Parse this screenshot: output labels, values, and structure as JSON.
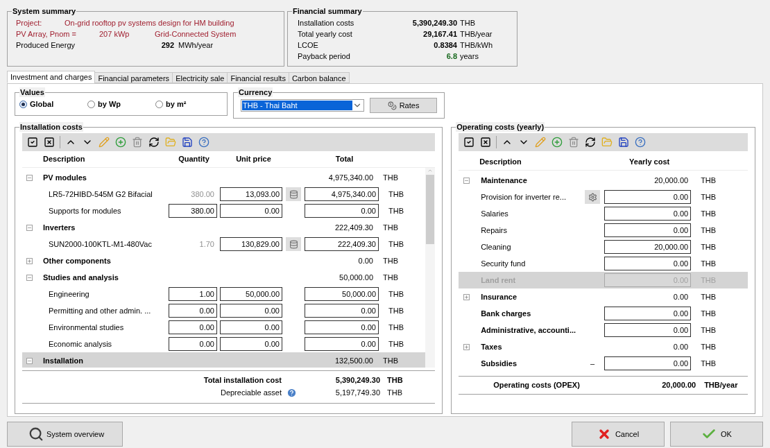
{
  "system_summary": {
    "title": "System summary",
    "rows": [
      {
        "label": "Project:",
        "value": "On-grid rooftop pv systems design for HM building",
        "kind": "project"
      },
      {
        "label": "PV Array, Pnom =",
        "value": "207 kWp",
        "extra": "Grid-Connected System",
        "kind": "array"
      },
      {
        "label": "Produced Energy",
        "value": "292",
        "unit": "MWh/year",
        "kind": "energy"
      }
    ]
  },
  "financial_summary": {
    "title": "Financial summary",
    "rows": [
      {
        "label": "Installation costs",
        "value": "5,390,249.30",
        "unit": "THB",
        "highlight": false
      },
      {
        "label": "Total yearly cost",
        "value": "29,167.41",
        "unit": "THB/year",
        "highlight": false
      },
      {
        "label": "LCOE",
        "value": "0.8384",
        "unit": "THB/kWh",
        "highlight": false
      },
      {
        "label": "Payback period",
        "value": "6.8",
        "unit": "years",
        "highlight": true
      }
    ]
  },
  "tabs": [
    {
      "label": "Investment and charges",
      "selected": true
    },
    {
      "label": "Financial parameters",
      "selected": false
    },
    {
      "label": "Electricity sale",
      "selected": false
    },
    {
      "label": "Financial results",
      "selected": false
    },
    {
      "label": "Carbon balance",
      "selected": false
    }
  ],
  "values": {
    "title": "Values",
    "options": [
      {
        "label": "Global",
        "selected": true
      },
      {
        "label": "by Wp",
        "selected": false
      },
      {
        "label": "by m²",
        "selected": false
      }
    ]
  },
  "currency": {
    "title": "Currency",
    "value": "THB - Thai Baht",
    "button": "Rates"
  },
  "installation_costs": {
    "title": "Installation costs",
    "columns": [
      "Description",
      "Quantity",
      "Unit price",
      "Total"
    ],
    "rows": [
      {
        "kind": "group",
        "label": "PV modules",
        "expanded": true,
        "total": "4,975,340.00",
        "unit": "THB",
        "selected": false
      },
      {
        "kind": "item",
        "label": "LR5-72HIBD-545M G2 Bifacial",
        "quantity": "380.00",
        "quantity_locked": true,
        "unit_price": "13,093.00",
        "database": true,
        "total": "4,975,340.00",
        "unit": "THB"
      },
      {
        "kind": "item",
        "label": "Supports for modules",
        "quantity": "380.00",
        "quantity_locked": false,
        "unit_price": "0.00",
        "database": false,
        "total": "0.00",
        "unit": "THB"
      },
      {
        "kind": "group",
        "label": "Inverters",
        "expanded": true,
        "total": "222,409.30",
        "unit": "THB",
        "selected": false
      },
      {
        "kind": "item",
        "label": "SUN2000-100KTL-M1-480Vac",
        "quantity": "1.70",
        "quantity_locked": true,
        "unit_price": "130,829.00",
        "database": true,
        "total": "222,409.30",
        "unit": "THB"
      },
      {
        "kind": "group",
        "label": "Other components",
        "expanded": false,
        "total": "0.00",
        "unit": "THB",
        "selected": false
      },
      {
        "kind": "group",
        "label": "Studies and analysis",
        "expanded": true,
        "total": "50,000.00",
        "unit": "THB",
        "selected": false
      },
      {
        "kind": "item",
        "label": "Engineering",
        "quantity": "1.00",
        "quantity_locked": false,
        "unit_price": "50,000.00",
        "database": false,
        "total": "50,000.00",
        "unit": "THB"
      },
      {
        "kind": "item",
        "label": "Permitting and other admin. ...",
        "quantity": "0.00",
        "quantity_locked": false,
        "unit_price": "0.00",
        "database": false,
        "total": "0.00",
        "unit": "THB"
      },
      {
        "kind": "item",
        "label": "Environmental studies",
        "quantity": "0.00",
        "quantity_locked": false,
        "unit_price": "0.00",
        "database": false,
        "total": "0.00",
        "unit": "THB"
      },
      {
        "kind": "item",
        "label": "Economic analysis",
        "quantity": "0.00",
        "quantity_locked": false,
        "unit_price": "0.00",
        "database": false,
        "total": "0.00",
        "unit": "THB"
      },
      {
        "kind": "group",
        "label": "Installation",
        "expanded": true,
        "total": "132,500.00",
        "unit": "THB",
        "selected": true
      }
    ],
    "total_label": "Total installation cost",
    "total": "5,390,249.30",
    "total_unit": "THB",
    "asset_label": "Depreciable asset",
    "asset": "5,197,749.30",
    "asset_unit": "THB"
  },
  "operating_costs": {
    "title": "Operating costs (yearly)",
    "columns": [
      "Description",
      "Yearly cost"
    ],
    "rows": [
      {
        "kind": "group",
        "label": "Maintenance",
        "expanded": true,
        "value": "20,000.00",
        "unit": "THB"
      },
      {
        "kind": "item",
        "label": "Provision for inverter re...",
        "value": "0.00",
        "unit": "THB",
        "gear": true,
        "disabled": false,
        "bold": false
      },
      {
        "kind": "item",
        "label": "Salaries",
        "value": "0.00",
        "unit": "THB",
        "gear": false,
        "disabled": false,
        "bold": false
      },
      {
        "kind": "item",
        "label": "Repairs",
        "value": "0.00",
        "unit": "THB",
        "gear": false,
        "disabled": false,
        "bold": false
      },
      {
        "kind": "item",
        "label": "Cleaning",
        "value": "20,000.00",
        "unit": "THB",
        "gear": false,
        "disabled": false,
        "bold": false
      },
      {
        "kind": "item",
        "label": "Security fund",
        "value": "0.00",
        "unit": "THB",
        "gear": false,
        "disabled": false,
        "bold": false
      },
      {
        "kind": "item",
        "label": "Land rent",
        "value": "0.00",
        "unit": "THB",
        "gear": false,
        "disabled": true,
        "bold": true
      },
      {
        "kind": "group",
        "label": "Insurance",
        "expanded": false,
        "value": "0.00",
        "unit": "THB"
      },
      {
        "kind": "top",
        "label": "Bank charges",
        "value": "0.00",
        "unit": "THB",
        "gear": false,
        "disabled": false,
        "bold": true
      },
      {
        "kind": "top",
        "label": "Administrative, accounti...",
        "value": "0.00",
        "unit": "THB",
        "gear": false,
        "disabled": false,
        "bold": true
      },
      {
        "kind": "group",
        "label": "Taxes",
        "expanded": false,
        "value": "0.00",
        "unit": "THB"
      },
      {
        "kind": "top",
        "label": "Subsidies",
        "sign": "–",
        "value": "0.00",
        "unit": "THB",
        "gear": false,
        "disabled": false,
        "bold": true
      }
    ],
    "total_label": "Operating costs (OPEX)",
    "total": "20,000.00",
    "total_unit": "THB/year"
  },
  "buttons": {
    "overview": "System overview",
    "cancel": "Cancel",
    "ok": "OK"
  }
}
